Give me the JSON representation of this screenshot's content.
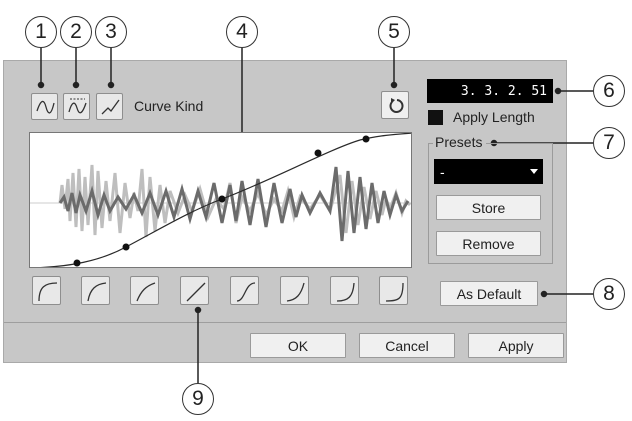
{
  "callouts": [
    "1",
    "2",
    "3",
    "4",
    "5",
    "6",
    "7",
    "8",
    "9"
  ],
  "curve_kind_label": "Curve Kind",
  "position_display": "3. 3. 2. 51",
  "apply_length_label": "Apply Length",
  "presets": {
    "label": "Presets",
    "selected": "-",
    "store_label": "Store",
    "remove_label": "Remove"
  },
  "as_default_label": "As Default",
  "buttons": {
    "ok": "OK",
    "cancel": "Cancel",
    "apply": "Apply"
  },
  "icons": {
    "curve_kinds": [
      "spline-curve-icon",
      "damped-spline-curve-icon",
      "linear-curve-icon"
    ],
    "reset": "reset-icon",
    "presets": [
      "curve-preset-1-icon",
      "curve-preset-2-icon",
      "curve-preset-3-icon",
      "curve-preset-linear-icon",
      "curve-preset-s-icon",
      "curve-preset-6-icon",
      "curve-preset-7-icon",
      "curve-preset-8-icon"
    ]
  },
  "colors": {
    "dialog_bg": "#c7c7c7",
    "display_bg": "#000000",
    "waveform_dark": "#6b6b6b",
    "waveform_light": "#bdbdbd"
  }
}
